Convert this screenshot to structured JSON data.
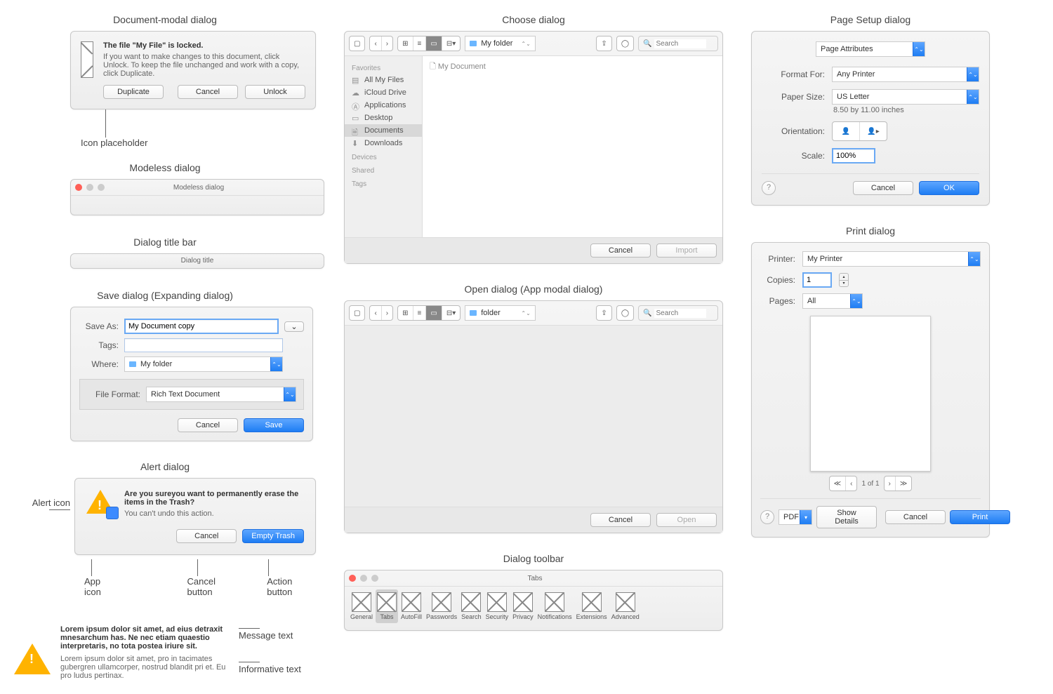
{
  "docmodal": {
    "title": "Document-modal dialog",
    "heading": "The file \"My File\" is locked.",
    "body": "If you want to make changes to this document, click Unlock. To keep the file unchanged and work with a copy, click Duplicate.",
    "duplicate": "Duplicate",
    "cancel": "Cancel",
    "unlock": "Unlock",
    "callout": "Icon placeholder"
  },
  "modeless": {
    "title": "Modeless dialog",
    "bar": "Modeless dialog"
  },
  "titlebar": {
    "title": "Dialog title bar",
    "text": "Dialog title"
  },
  "save": {
    "title": "Save dialog (Expanding dialog)",
    "saveas_label": "Save As:",
    "saveas_value": "My Document copy",
    "tags_label": "Tags:",
    "where_label": "Where:",
    "where_value": "My folder",
    "fileformat_label": "File Format:",
    "fileformat_value": "Rich Text Document",
    "cancel": "Cancel",
    "save": "Save"
  },
  "alert": {
    "title": "Alert dialog",
    "heading": "Are you sureyou want to permanently erase the items in the Trash?",
    "body": "You can't undo this action.",
    "cancel": "Cancel",
    "action": "Empty Trash",
    "callout_alert_icon": "Alert icon",
    "callout_app_icon": "App icon",
    "callout_cancel": "Cancel button",
    "callout_action": "Action button"
  },
  "lorem": {
    "bold": "Lorem ipsum dolor sit amet, ad eius detraxit mnesarchum has. Ne nec etiam quaestio interpretaris, no tota postea iriure sit.",
    "plain": "Lorem ipsum dolor sit amet, pro in tacimates gubergren ullamcorper, nostrud blandit pri et. Eu pro ludus pertinax.",
    "callout_msg": "Message text",
    "callout_info": "Informative text"
  },
  "choose": {
    "title": "Choose dialog",
    "path": "My folder",
    "doc": "My Document",
    "search": "Search",
    "cancel": "Cancel",
    "import": "Import",
    "sidebar": {
      "favorites": "Favorites",
      "items": [
        "All My Files",
        "iCloud Drive",
        "Applications",
        "Desktop",
        "Documents",
        "Downloads"
      ],
      "devices": "Devices",
      "shared": "Shared",
      "tags": "Tags"
    }
  },
  "open": {
    "title": "Open dialog (App modal dialog)",
    "path": "folder",
    "search": "Search",
    "cancel": "Cancel",
    "open": "Open"
  },
  "toolbar": {
    "title": "Dialog toolbar",
    "tabs_label": "Tabs",
    "tabs": [
      "General",
      "Tabs",
      "AutoFill",
      "Passwords",
      "Search",
      "Security",
      "Privacy",
      "Notifications",
      "Extensions",
      "Advanced"
    ]
  },
  "pagesetup": {
    "title": "Page Setup dialog",
    "attrs": "Page Attributes",
    "formatfor_label": "Format For:",
    "formatfor_value": "Any Printer",
    "papersize_label": "Paper Size:",
    "papersize_value": "US Letter",
    "papersize_hint": "8.50 by 11.00 inches",
    "orientation_label": "Orientation:",
    "scale_label": "Scale:",
    "scale_value": "100%",
    "cancel": "Cancel",
    "ok": "OK"
  },
  "print": {
    "title": "Print dialog",
    "printer_label": "Printer:",
    "printer_value": "My Printer",
    "copies_label": "Copies:",
    "copies_value": "1",
    "pages_label": "Pages:",
    "pages_value": "All",
    "pager": "1 of 1",
    "pdf": "PDF",
    "details": "Show Details",
    "cancel": "Cancel",
    "print": "Print"
  }
}
